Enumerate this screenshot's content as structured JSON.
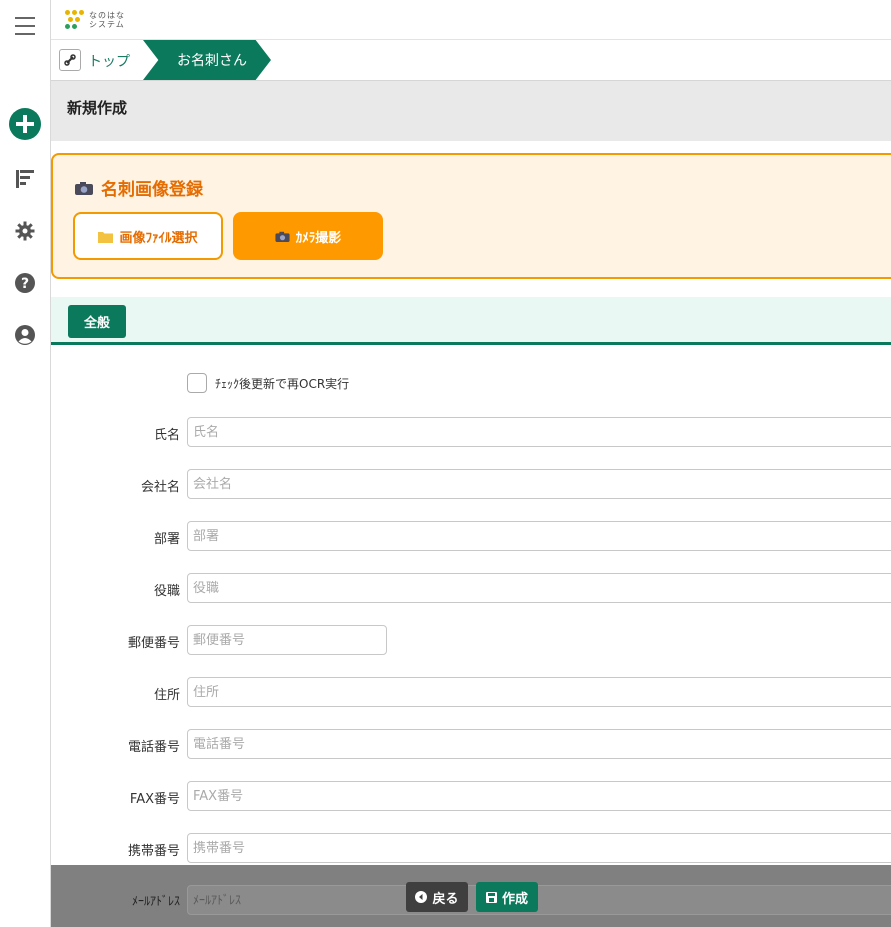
{
  "brand": {
    "logo_line1": "なのはな",
    "logo_line2": "システム"
  },
  "breadcrumb": {
    "top": "トップ",
    "current": "お名刺さん"
  },
  "page": {
    "title": "新規作成"
  },
  "card_register": {
    "title": "名刺画像登録",
    "file_button": "画像ﾌｧｲﾙ選択",
    "camera_button": "ｶﾒﾗ撮影"
  },
  "tabs": {
    "all": "全般"
  },
  "form": {
    "recheck_label": "ﾁｪｯｸ後更新で再OCR実行",
    "fields": [
      {
        "label": "氏名",
        "placeholder": "氏名"
      },
      {
        "label": "会社名",
        "placeholder": "会社名"
      },
      {
        "label": "部署",
        "placeholder": "部署"
      },
      {
        "label": "役職",
        "placeholder": "役職"
      },
      {
        "label": "郵便番号",
        "placeholder": "郵便番号"
      },
      {
        "label": "住所",
        "placeholder": "住所"
      },
      {
        "label": "電話番号",
        "placeholder": "電話番号"
      },
      {
        "label": "FAX番号",
        "placeholder": "FAX番号"
      },
      {
        "label": "携帯番号",
        "placeholder": "携帯番号"
      },
      {
        "label": "ﾒｰﾙｱﾄﾞﾚｽ",
        "placeholder": "ﾒｰﾙｱﾄﾞﾚｽ"
      }
    ]
  },
  "actions": {
    "back": "戻る",
    "create": "作成"
  },
  "colors": {
    "accent": "#0b7a5c",
    "orange": "#ff9900",
    "orange_text": "#e56c00"
  }
}
